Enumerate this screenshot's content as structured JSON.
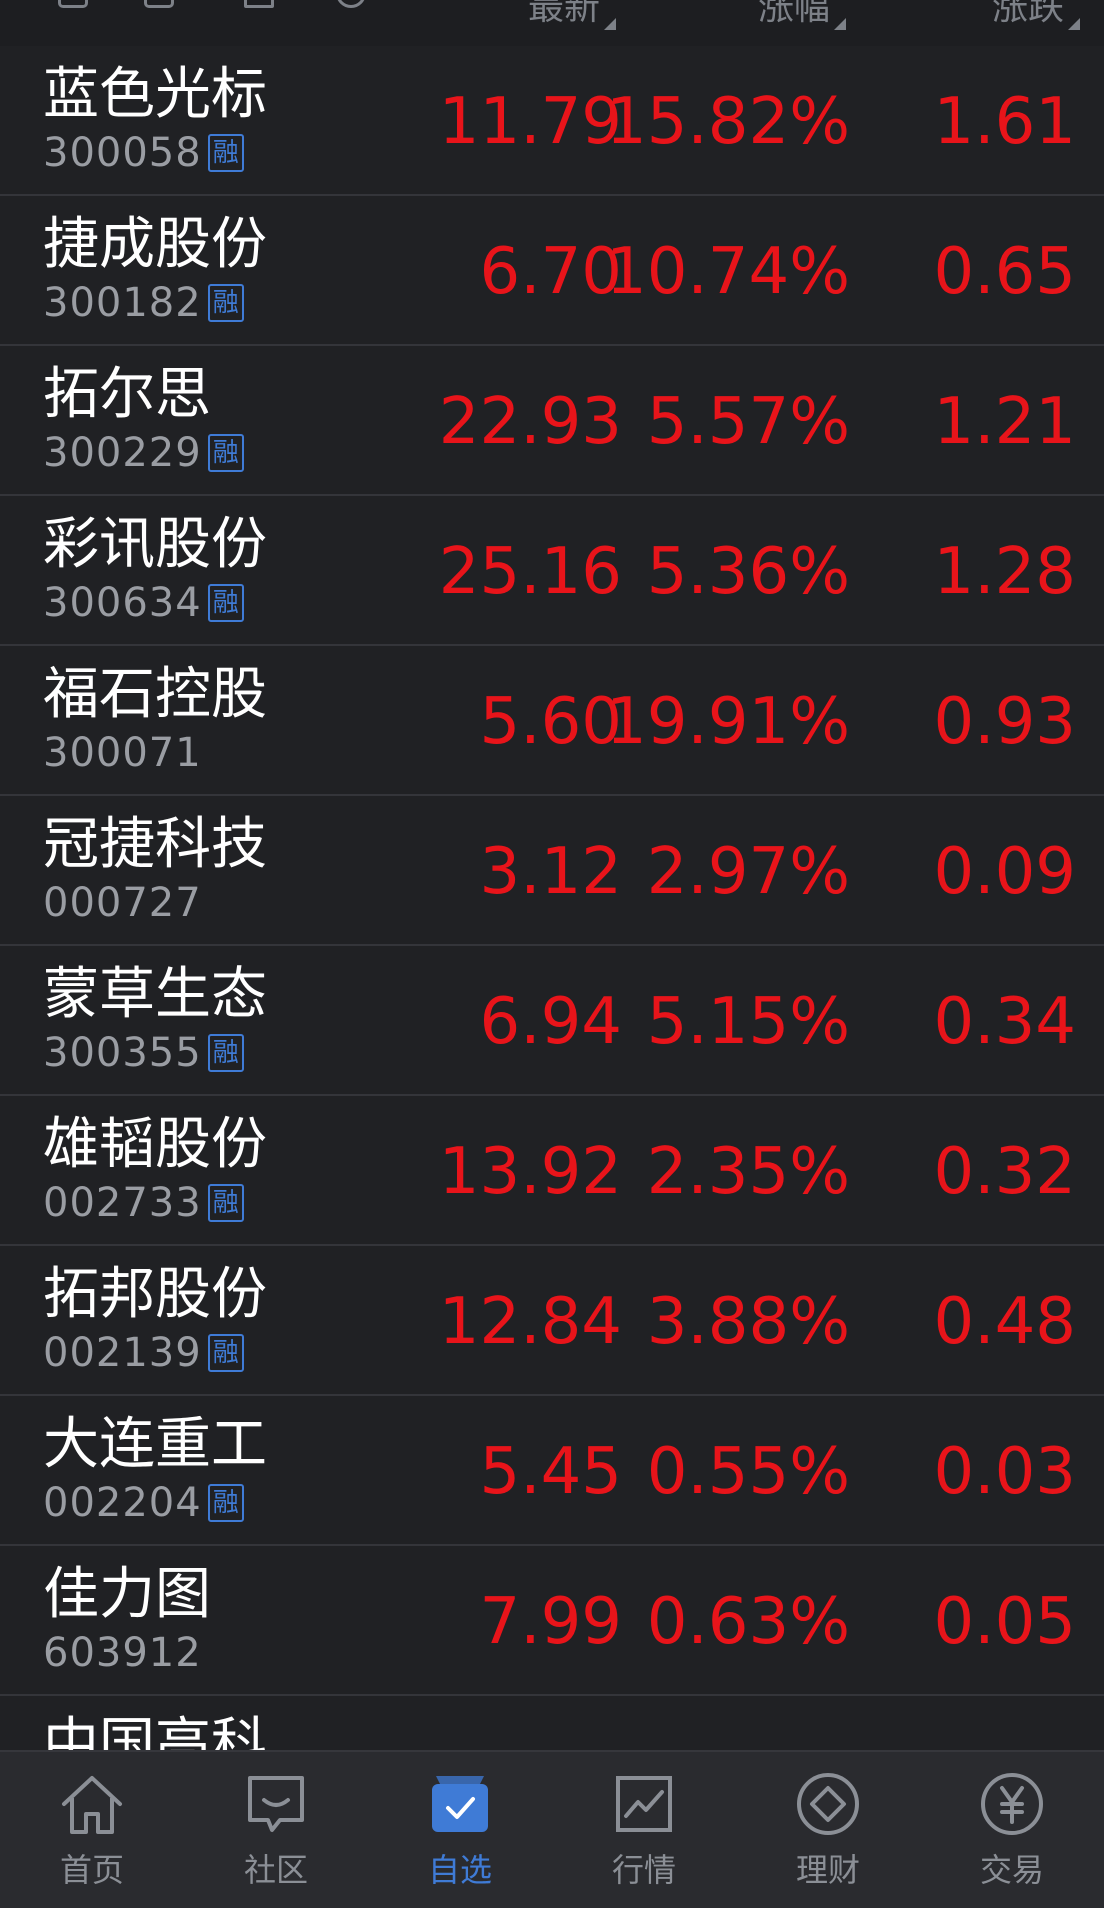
{
  "header": {
    "columns": [
      "最新",
      "涨幅",
      "涨跌"
    ]
  },
  "stocks": [
    {
      "name": "蓝色光标",
      "code": "300058",
      "badge": "融",
      "price": "11.79",
      "pct": "15.82%",
      "chg": "1.61"
    },
    {
      "name": "捷成股份",
      "code": "300182",
      "badge": "融",
      "price": "6.70",
      "pct": "10.74%",
      "chg": "0.65"
    },
    {
      "name": "拓尔思",
      "code": "300229",
      "badge": "融",
      "price": "22.93",
      "pct": "5.57%",
      "chg": "1.21"
    },
    {
      "name": "彩讯股份",
      "code": "300634",
      "badge": "融",
      "price": "25.16",
      "pct": "5.36%",
      "chg": "1.28"
    },
    {
      "name": "福石控股",
      "code": "300071",
      "badge": "",
      "price": "5.60",
      "pct": "19.91%",
      "chg": "0.93"
    },
    {
      "name": "冠捷科技",
      "code": "000727",
      "badge": "",
      "price": "3.12",
      "pct": "2.97%",
      "chg": "0.09"
    },
    {
      "name": "蒙草生态",
      "code": "300355",
      "badge": "融",
      "price": "6.94",
      "pct": "5.15%",
      "chg": "0.34"
    },
    {
      "name": "雄韬股份",
      "code": "002733",
      "badge": "融",
      "price": "13.92",
      "pct": "2.35%",
      "chg": "0.32"
    },
    {
      "name": "拓邦股份",
      "code": "002139",
      "badge": "融",
      "price": "12.84",
      "pct": "3.88%",
      "chg": "0.48"
    },
    {
      "name": "大连重工",
      "code": "002204",
      "badge": "融",
      "price": "5.45",
      "pct": "0.55%",
      "chg": "0.03"
    },
    {
      "name": "佳力图",
      "code": "603912",
      "badge": "",
      "price": "7.99",
      "pct": "0.63%",
      "chg": "0.05"
    },
    {
      "name": "中国高科",
      "code": "",
      "badge": "",
      "price": "",
      "pct": "",
      "chg": ""
    }
  ],
  "nav": {
    "items": [
      {
        "label": "首页",
        "icon": "home-icon",
        "active": false
      },
      {
        "label": "社区",
        "icon": "community-icon",
        "active": false
      },
      {
        "label": "自选",
        "icon": "watchlist-icon",
        "active": true
      },
      {
        "label": "行情",
        "icon": "market-chart-icon",
        "active": false
      },
      {
        "label": "理财",
        "icon": "wealth-icon",
        "active": false
      },
      {
        "label": "交易",
        "icon": "yuan-trade-icon",
        "active": false
      }
    ]
  },
  "colors": {
    "background": "#202124",
    "up": "#e8141a",
    "accent": "#3f7bd6",
    "muted": "#8b8f96"
  }
}
